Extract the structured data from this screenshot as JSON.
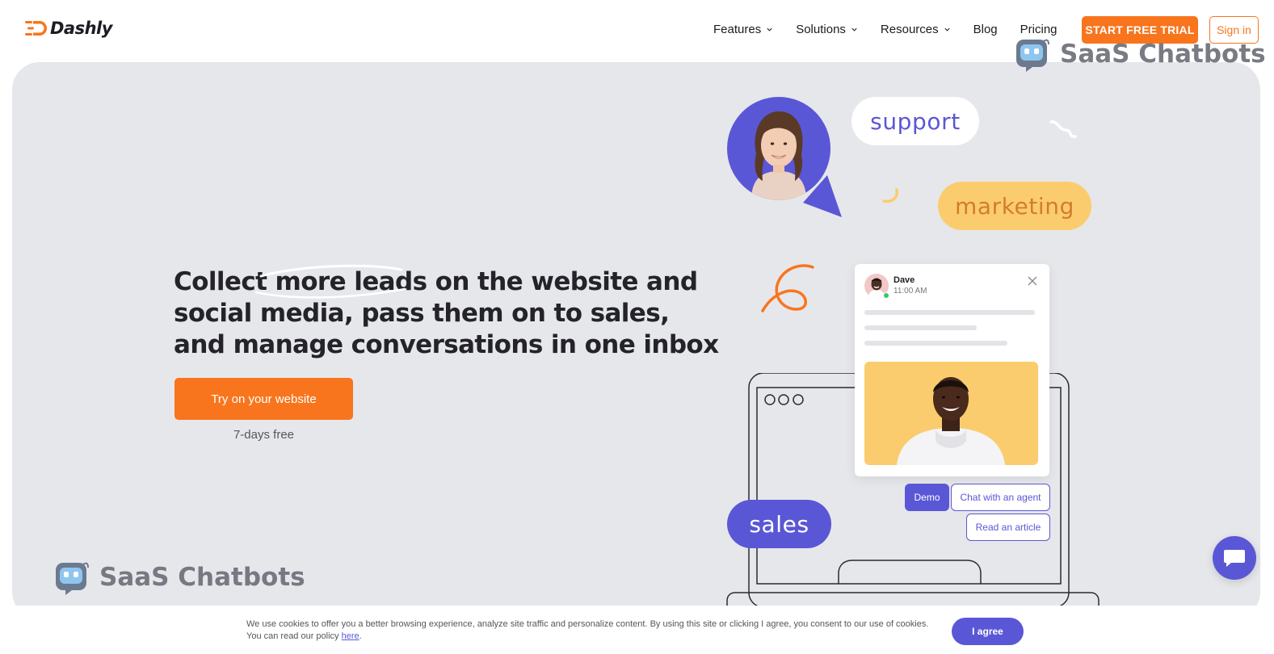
{
  "header": {
    "logo_text": "Dashly",
    "nav": [
      {
        "label": "Features",
        "has_dropdown": true
      },
      {
        "label": "Solutions",
        "has_dropdown": true
      },
      {
        "label": "Resources",
        "has_dropdown": true
      },
      {
        "label": "Blog",
        "has_dropdown": false
      },
      {
        "label": "Pricing",
        "has_dropdown": false
      }
    ],
    "trial_button": "START FREE TRIAL",
    "signin_button": "Sign in"
  },
  "watermark": {
    "text": "SaaS Chatbots"
  },
  "hero": {
    "headline_lines": [
      "Collect more leads on the website and",
      "social media, pass them on to sales,",
      "and manage conversations in one inbox"
    ],
    "cta_button": "Try on your website",
    "cta_note": "7-days free"
  },
  "illustration": {
    "bubbles": {
      "support": "support",
      "marketing": "marketing",
      "sales": "sales"
    },
    "chat": {
      "name": "Dave",
      "time": "11:00 AM"
    },
    "chips": {
      "demo": "Demo",
      "agent": "Chat with an agent",
      "article": "Read an article"
    }
  },
  "cookie": {
    "text": "We use cookies to offer you a better browsing experience, analyze site traffic and personalize content. By using this site or clicking I agree, you consent to our use of cookies. You can read our policy ",
    "link": "here",
    "tail": ".",
    "agree_button": "I agree"
  },
  "colors": {
    "accent_orange": "#f8751e",
    "accent_purple": "#5a57d6",
    "hero_bg": "#e6e7eb",
    "marketing_bg": "#fbcc6d"
  }
}
